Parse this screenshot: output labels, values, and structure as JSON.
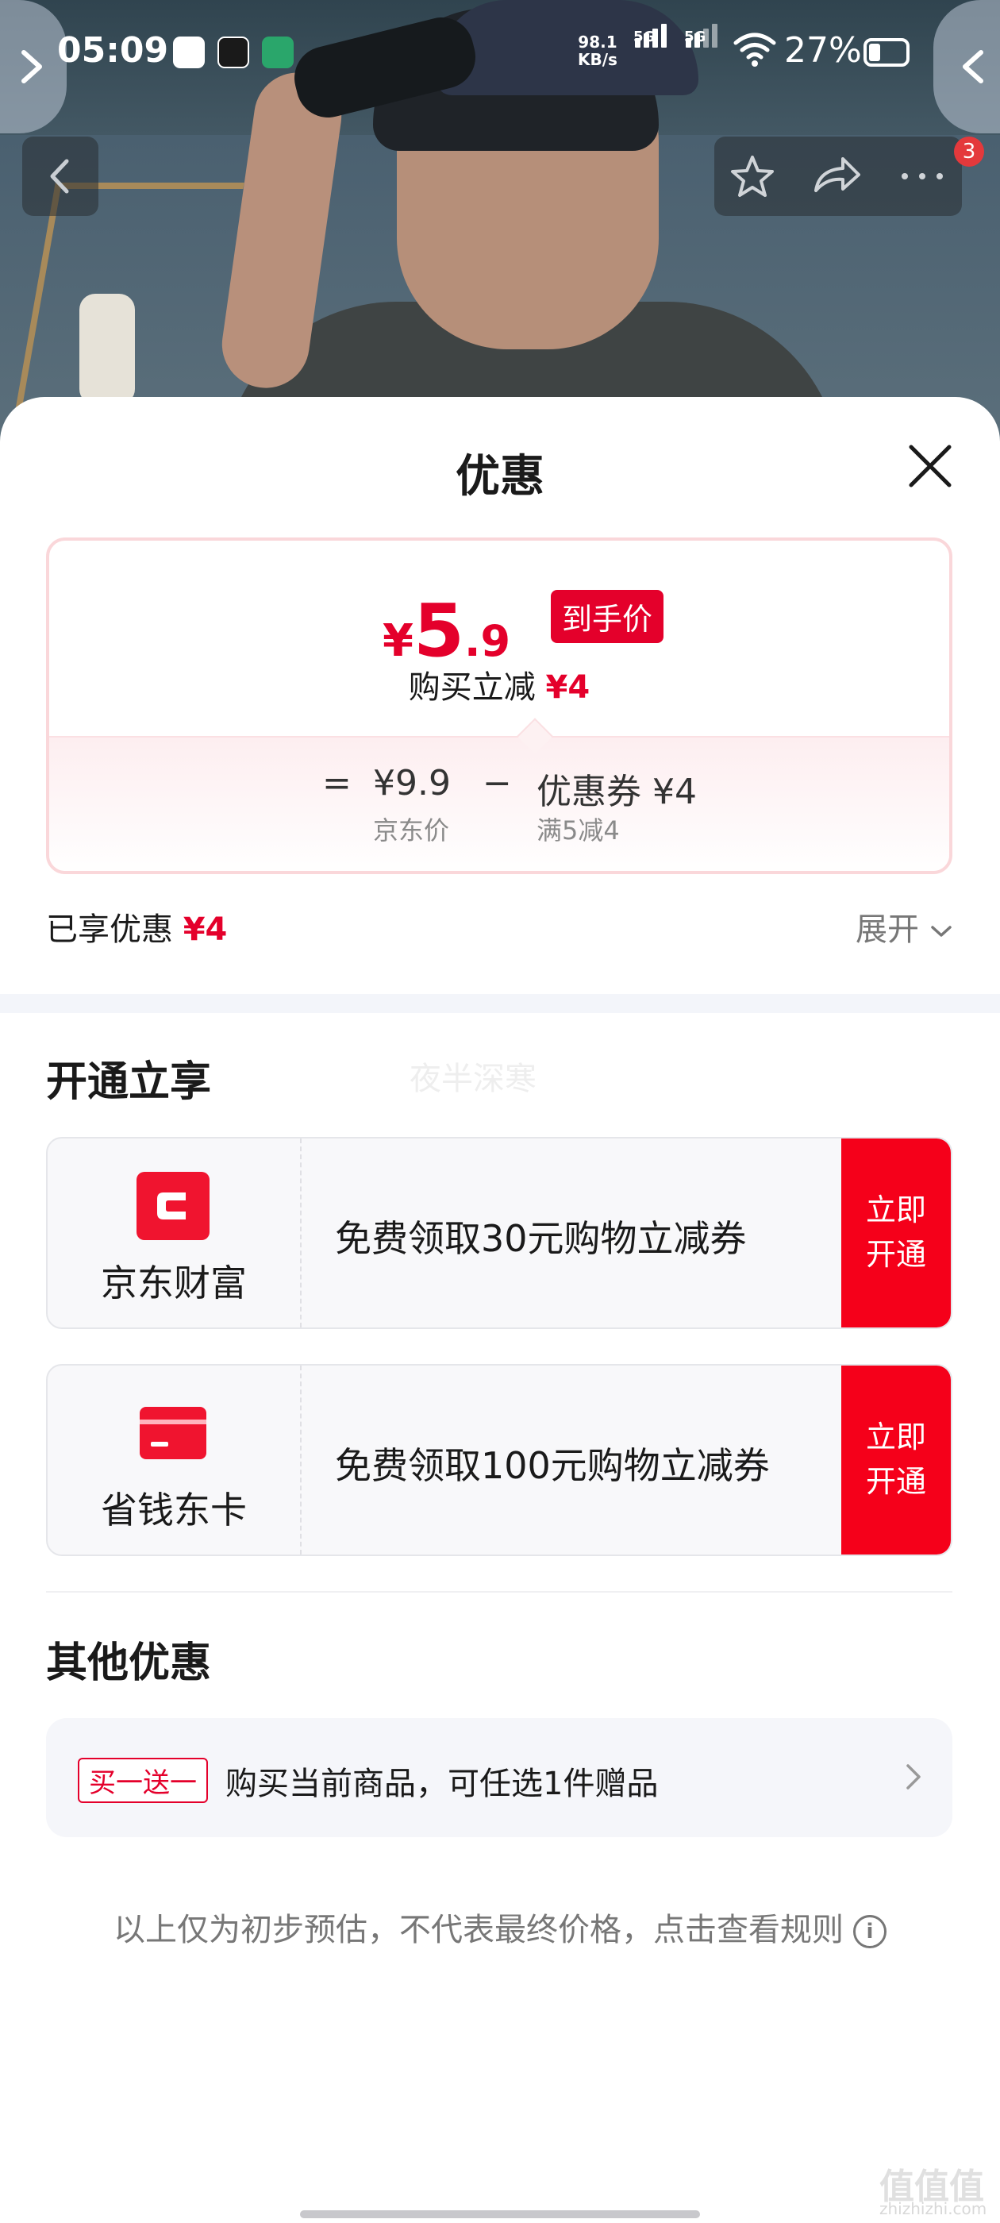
{
  "status_bar": {
    "time": "05:09",
    "net_speed_value": "98.1",
    "net_speed_unit": "KB/s",
    "sim1": "5G",
    "sim2": "5G",
    "battery": "27%"
  },
  "top_bar": {
    "cart_badge": "3"
  },
  "sheet": {
    "title": "优惠",
    "price_card": {
      "currency": "¥",
      "final_int": "5",
      "final_dec": ".9",
      "final_tag": "到手价",
      "reduce_label": "购买立减",
      "reduce_amount": "¥4",
      "equals": "=",
      "base_price": "¥9.9",
      "base_label": "京东价",
      "minus": "−",
      "coupon_price": "优惠券 ¥4",
      "coupon_label": "满5减4"
    },
    "enjoyed_label": "已享优惠",
    "enjoyed_amount": "¥4",
    "expand_label": "展开",
    "open_section": {
      "title": "开通立享",
      "watermark": "夜半深寒",
      "cards": [
        {
          "brand": "京东财富",
          "desc": "免费领取30元购物立减券",
          "cta_line1": "立即",
          "cta_line2": "开通"
        },
        {
          "brand": "省钱东卡",
          "desc": "免费领取100元购物立减券",
          "cta_line1": "立即",
          "cta_line2": "开通"
        }
      ]
    },
    "other_section": {
      "title": "其他优惠",
      "gift_tag": "买一送一",
      "gift_text": "购买当前商品，可任选1件赠品"
    },
    "disclaimer": "以上仅为初步预估，不代表最终价格，点击查看规则",
    "site_watermark": "值值值",
    "site_url": "zhizhizhi.com"
  },
  "colors": {
    "accent": "#e4002b",
    "cta": "#f5001a"
  }
}
